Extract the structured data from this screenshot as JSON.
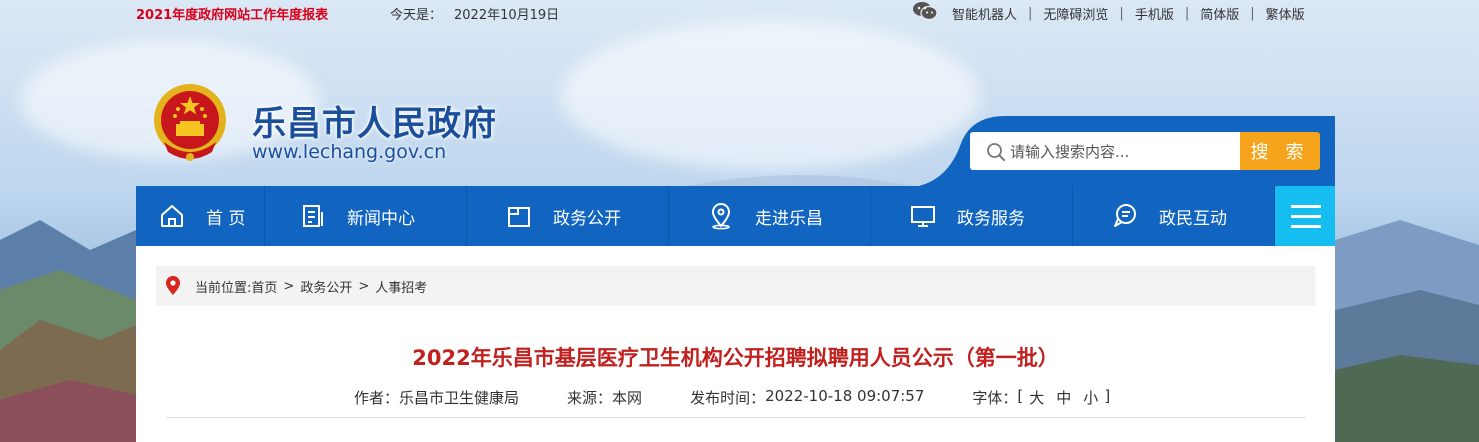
{
  "topbar": {
    "report_link": "2021年度政府网站工作年度报表",
    "today_label": "今天是：",
    "today_date": "2022年10月19日",
    "links": [
      "智能机器人",
      "无障碍浏览",
      "手机版",
      "简体版",
      "繁体版"
    ]
  },
  "header": {
    "site_title": "乐昌市人民政府",
    "site_url": "www.lechang.gov.cn"
  },
  "search": {
    "placeholder": "请输入搜索内容...",
    "button_label": "搜 索"
  },
  "nav": {
    "items": [
      {
        "label": "首 页",
        "icon": "home-icon"
      },
      {
        "label": "新闻中心",
        "icon": "document-icon"
      },
      {
        "label": "政务公开",
        "icon": "folder-icon"
      },
      {
        "label": "走进乐昌",
        "icon": "location-icon"
      },
      {
        "label": "政务服务",
        "icon": "monitor-icon"
      },
      {
        "label": "政民互动",
        "icon": "chat-icon"
      }
    ],
    "menu_icon": "hamburger-menu-icon"
  },
  "breadcrumb": {
    "prefix": "当前位置:",
    "items": [
      "首页",
      "政务公开",
      "人事招考"
    ],
    "separator": ">"
  },
  "article": {
    "title": "2022年乐昌市基层医疗卫生机构公开招聘拟聘用人员公示（第一批）",
    "author_label": "作者：",
    "author": "乐昌市卫生健康局",
    "source_label": "来源：",
    "source": "本网",
    "publish_label": "发布时间：",
    "publish_time": "2022-10-18 09:07:57",
    "font_label": "字体：",
    "font_open": "[",
    "font_sizes": [
      "大",
      "中",
      "小"
    ],
    "font_close": "]"
  },
  "colors": {
    "nav_blue": "#1165c0",
    "menu_cyan": "#16bdf0",
    "search_orange": "#f5a41c",
    "title_red": "#c0211f",
    "report_red": "#d9001b",
    "site_blue": "#1b4f9c"
  }
}
